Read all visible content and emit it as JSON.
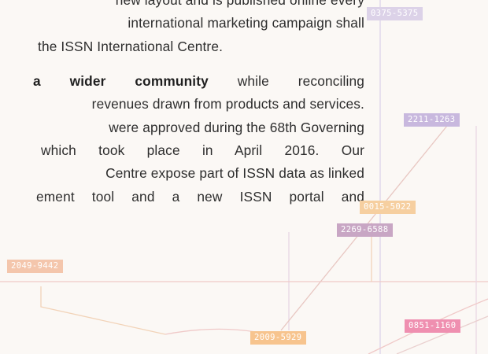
{
  "article": {
    "lines": [
      "new layout and is published online every",
      "international marketing campaign shall",
      "the ISSN International Centre.",
      "a wider community",
      "while reconciling",
      "revenues drawn from products and services.",
      "were approved during the 68th Governing",
      "which took place in April 2016. Our",
      "Centre expose part of ISSN data as linked",
      "ement tool and a new ISSN portal and"
    ]
  },
  "issn_tags": [
    {
      "id": "0375-5375",
      "color": "#dcd2e8"
    },
    {
      "id": "2211-1263",
      "color": "#c8b8de"
    },
    {
      "id": "0015-5022",
      "color": "#f6cfa0"
    },
    {
      "id": "2269-6588",
      "color": "#c8a6c4"
    },
    {
      "id": "2049-9442",
      "color": "#f4c6ac"
    },
    {
      "id": "2009-5929",
      "color": "#f7c48e"
    },
    {
      "id": "0851-1160",
      "color": "#ef8fb0"
    }
  ],
  "colors": {
    "link_lavender": "#dcd3ea",
    "link_pink": "#f0c9c8",
    "link_orange": "#f2d3b8"
  }
}
